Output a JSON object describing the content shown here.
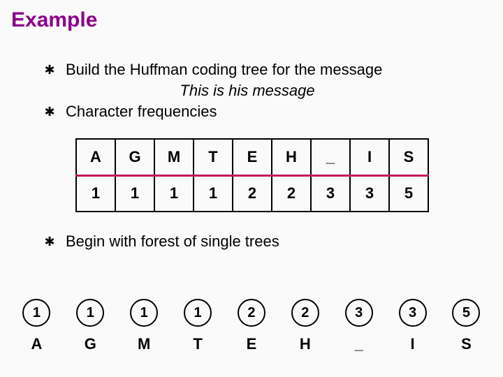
{
  "title": "Example",
  "bullets": {
    "b1": "Build the Huffman coding tree for the message",
    "b1_sub": "This is his message",
    "b2": "Character frequencies",
    "b3": "Begin with forest of single trees"
  },
  "freq_table": {
    "chars": [
      "A",
      "G",
      "M",
      "T",
      "E",
      "H",
      "_",
      "I",
      "S"
    ],
    "counts": [
      "1",
      "1",
      "1",
      "1",
      "2",
      "2",
      "3",
      "3",
      "5"
    ]
  },
  "forest": [
    {
      "count": "1",
      "char": "A"
    },
    {
      "count": "1",
      "char": "G"
    },
    {
      "count": "1",
      "char": "M"
    },
    {
      "count": "1",
      "char": "T"
    },
    {
      "count": "2",
      "char": "E"
    },
    {
      "count": "2",
      "char": "H"
    },
    {
      "count": "3",
      "char": "_"
    },
    {
      "count": "3",
      "char": "I"
    },
    {
      "count": "5",
      "char": "S"
    }
  ]
}
